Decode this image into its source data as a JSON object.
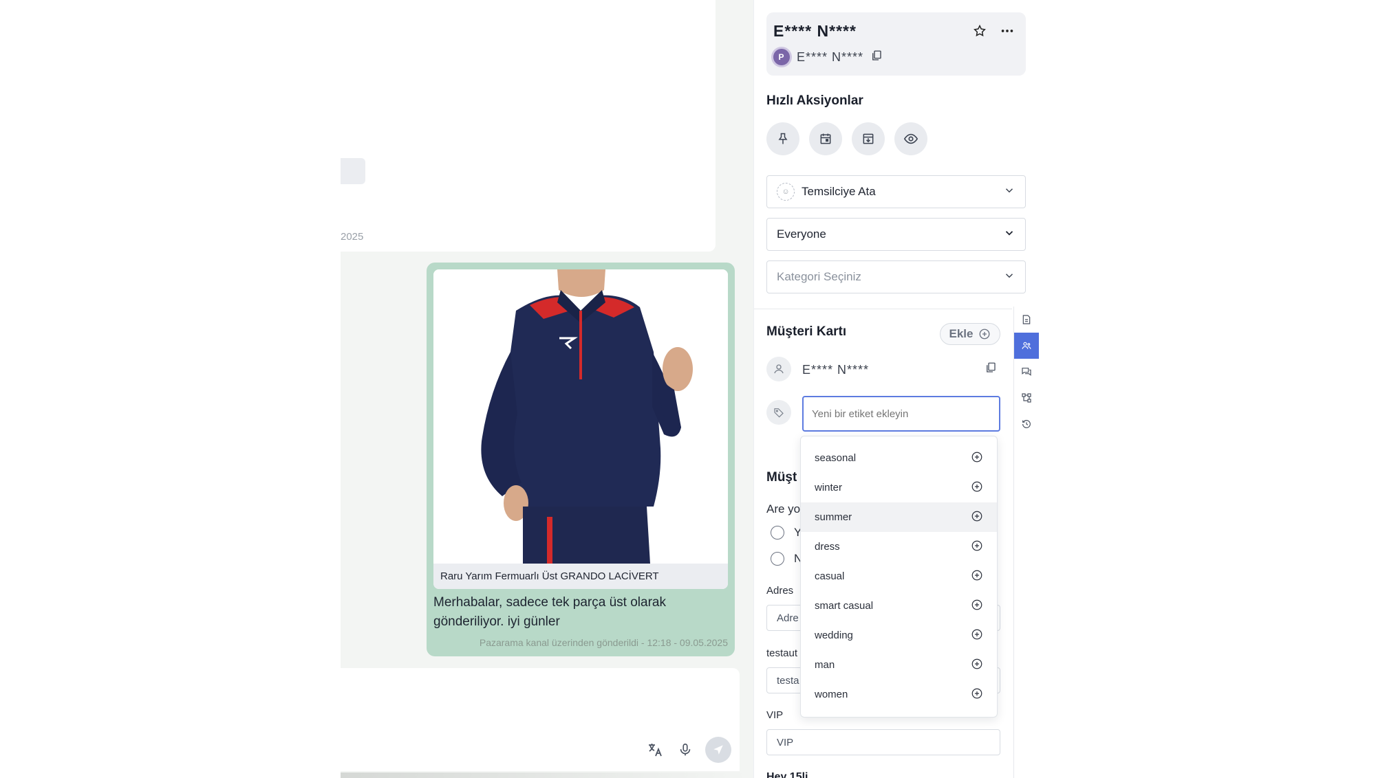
{
  "chat": {
    "incoming_timestamp_fragment": "2025",
    "product_caption": "Raru Yarım Fermuarlı Üst GRANDO LACİVERT",
    "message_text": "Merhabalar, sadece tek parça üst olarak gönderiliyor. iyi günler",
    "message_meta": "Pazarama kanal üzerinden gönderildi - 12:18 - 09.05.2025",
    "bubble_color": "#b8d9c8",
    "composer_icons": [
      "translate-icon",
      "microphone-icon",
      "send-icon"
    ]
  },
  "contact": {
    "name": "E**** N****",
    "channel_badge": "P",
    "handle": "E**** N****"
  },
  "quick_actions": {
    "title": "Hızlı Aksiyonlar",
    "buttons": [
      "pin-icon",
      "calendar-icon",
      "archive-icon",
      "eye-icon"
    ]
  },
  "selects": {
    "assign": "Temsilciye Ata",
    "visibility": "Everyone",
    "category_placeholder": "Kategori Seçiniz"
  },
  "customer_card": {
    "title": "Müşteri Kartı",
    "add_label": "Ekle",
    "customer_name": "E**** N****",
    "tag_placeholder": "Yeni bir etiket ekleyin"
  },
  "customer_fields": {
    "section_title_fragment": "Müşt",
    "question_fragment": "Are yo",
    "radio_1_fragment": "Y",
    "radio_2_fragment": "N",
    "address_label": "Adres",
    "address_value_fragment": "Adre",
    "testauto_label": "testaut",
    "testauto_value_fragment": "testa",
    "vip_label": "VIP",
    "vip_placeholder": "VIP",
    "next_label": "Hey 15li"
  },
  "tag_dropdown": {
    "items": [
      "seasonal",
      "winter",
      "summer",
      "dress",
      "casual",
      "smart casual",
      "wedding",
      "man",
      "women"
    ],
    "hovered": "summer"
  },
  "side_tabs": [
    "document-icon",
    "users-icon",
    "chat-icon",
    "flow-icon",
    "history-icon"
  ],
  "accent_color": "#4f6fdc"
}
